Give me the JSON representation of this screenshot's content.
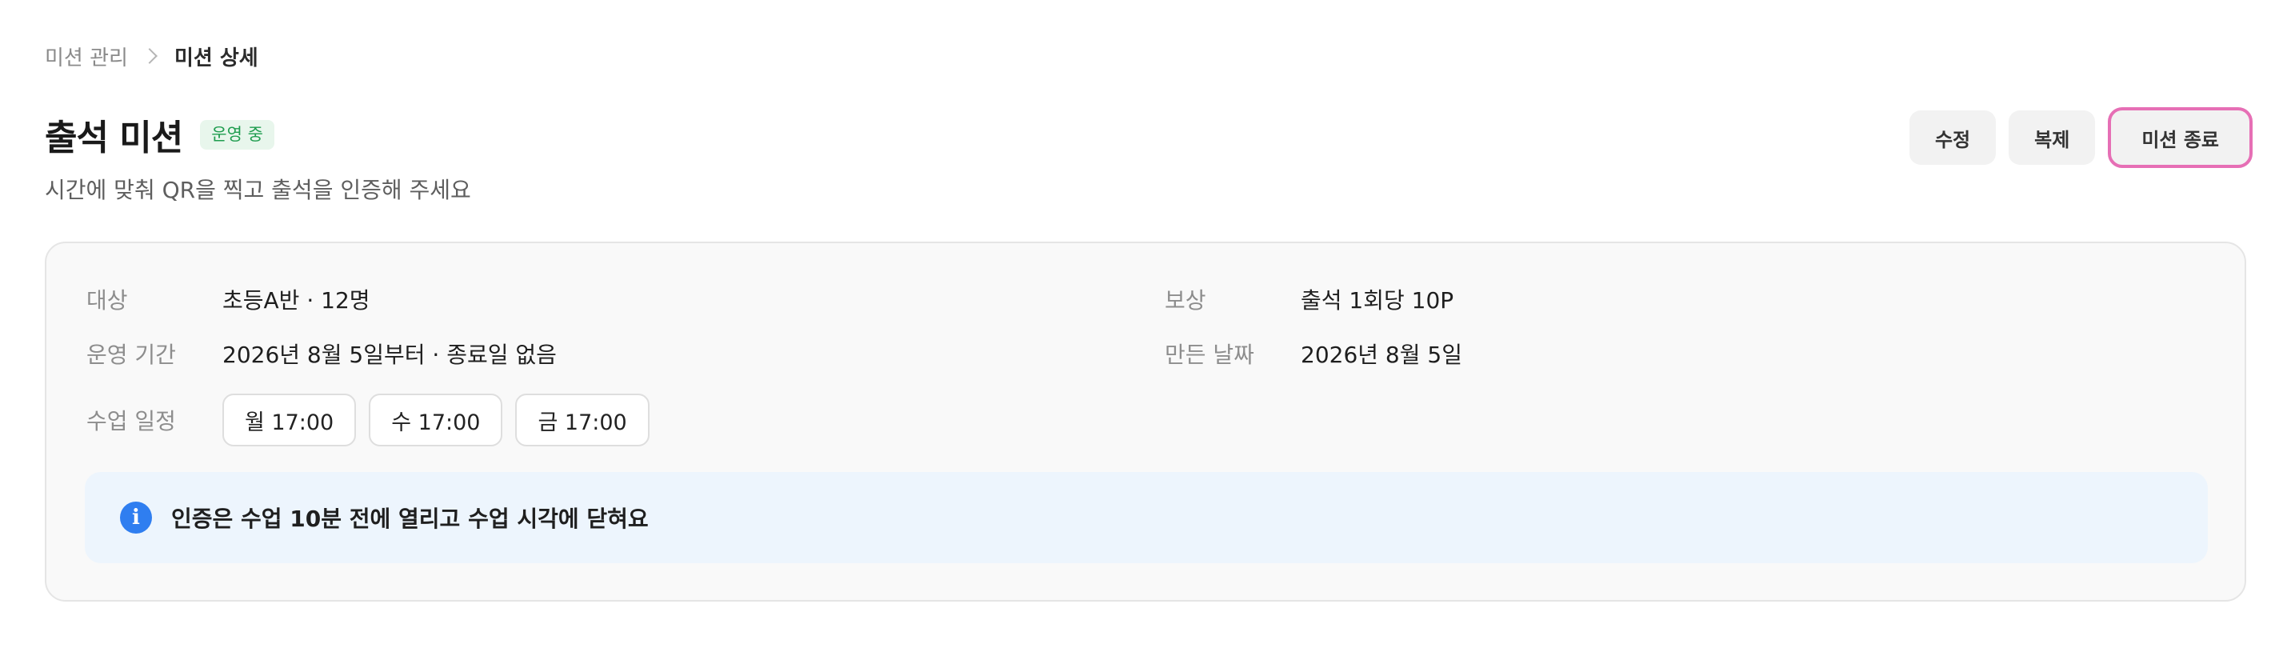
{
  "breadcrumb": {
    "parent": "미션 관리",
    "current": "미션 상세"
  },
  "header": {
    "title": "출석 미션",
    "status": "운영 중",
    "subtitle": "시간에 맞춰 QR을 찍고 출석을 인증해 주세요"
  },
  "actions": {
    "edit": "수정",
    "duplicate": "복제",
    "end": "미션 종료"
  },
  "details": {
    "target_label": "대상",
    "target_value": "초등A반 · 12명",
    "period_label": "운영 기간",
    "period_value": "2026년 8월 5일부터 · 종료일 없음",
    "reward_label": "보상",
    "reward_value": "출석 1회당 10P",
    "created_label": "만든 날짜",
    "created_value": "2026년 8월 5일",
    "schedule_label": "수업 일정",
    "schedule": [
      "월 17:00",
      "수 17:00",
      "금 17:00"
    ]
  },
  "notice": {
    "icon": "info-icon",
    "text": "인증은 수업 10분 전에 열리고 수업 시각에 닫혀요"
  },
  "colors": {
    "status_badge_bg": "#e8f6ec",
    "status_badge_text": "#1f9d4f",
    "end_button_highlight": "#e66fb5",
    "notice_bg": "#edf5fd",
    "info_icon": "#2f7ef0"
  }
}
